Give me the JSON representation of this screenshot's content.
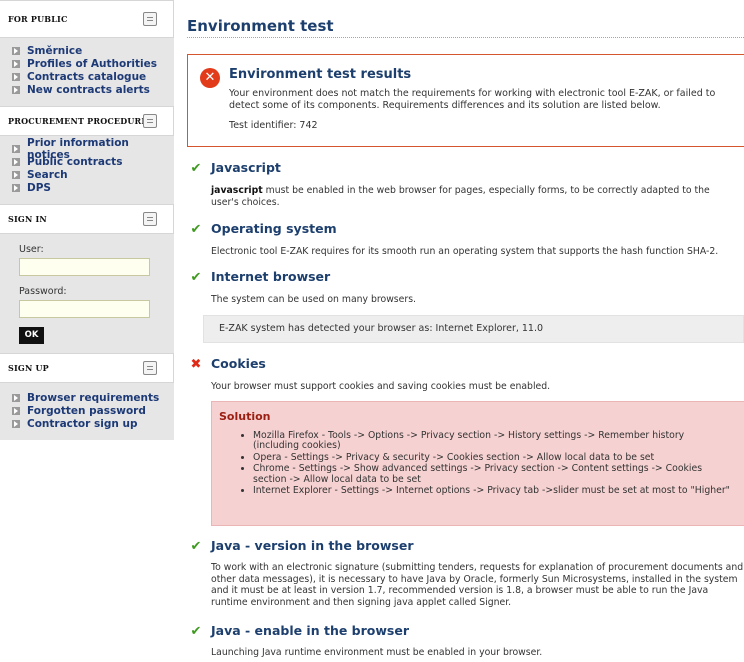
{
  "sidebar": {
    "public": {
      "title": "FOR PUBLIC",
      "icon": "printer-icon",
      "links": [
        "Směrnice",
        "Profiles of Authorities",
        "Contracts catalogue",
        "New contracts alerts"
      ]
    },
    "procurement": {
      "title": "PROCUREMENT PROCEDURES",
      "icon": "document-icon",
      "links": [
        "Prior information notices",
        "Public contracts",
        "Search",
        "DPS"
      ]
    },
    "signin": {
      "title": "SIGN IN",
      "icon": "lock-icon",
      "user_label": "User:",
      "password_label": "Password:",
      "user_value": "",
      "password_value": "",
      "ok_label": "OK"
    },
    "signup": {
      "title": "SIGN UP",
      "icon": "user-add-icon",
      "links": [
        "Browser requirements",
        "Forgotten password",
        "Contractor sign up"
      ]
    }
  },
  "main": {
    "title": "Environment test",
    "results": {
      "title": "Environment test results",
      "text": "Your environment does not match the requirements for working with electronic tool E-ZAK, or failed to detect some of its components. Requirements differences and its solution are listed below.",
      "test_id": "Test identifier: 742"
    },
    "sections": {
      "javascript": {
        "status": "ok",
        "title": "Javascript",
        "bold": "javascript",
        "text": " must be enabled in the web browser for pages, especially forms, to be correctly adapted to the user's choices."
      },
      "os": {
        "status": "ok",
        "title": "Operating system",
        "text": "Electronic tool E-ZAK requires for its smooth run an operating system that supports the hash function SHA-2."
      },
      "browser": {
        "status": "ok",
        "title": "Internet browser",
        "text": "The system can be used on many browsers.",
        "detected": "E-ZAK system has detected your browser as: Internet Explorer, 11.0"
      },
      "cookies": {
        "status": "error",
        "title": "Cookies",
        "text": "Your browser must support cookies and saving cookies must be enabled.",
        "solution_title": "Solution",
        "solution_items": [
          "Mozilla Firefox - Tools -> Options -> Privacy section -> History settings -> Remember history (including cookies)",
          "Opera - Settings -> Privacy & security -> Cookies section -> Allow local data to be set",
          "Chrome - Settings -> Show advanced settings -> Privacy section -> Content settings -> Cookies section -> Allow local data to be set",
          "Internet Explorer - Settings -> Internet options -> Privacy tab ->slider must be set at most to \"Higher\""
        ]
      },
      "java_version": {
        "status": "ok",
        "title": "Java - version in the browser",
        "text": "To work with an electronic signature (submitting tenders, requests for explanation of procurement documents and other data messages), it is necessary to have Java by Oracle, formerly Sun Microsystems, installed in the system and it must be at least in version 1.7, recommended version is 1.8, a browser must be able to run the Java runtime environment and then signing java applet called Signer."
      },
      "java_enable": {
        "status": "ok",
        "title": "Java - enable in the browser",
        "text": "Launching Java runtime environment must be enabled in your browser."
      }
    },
    "marks": {
      "ok": "✔",
      "error": "✖"
    }
  }
}
